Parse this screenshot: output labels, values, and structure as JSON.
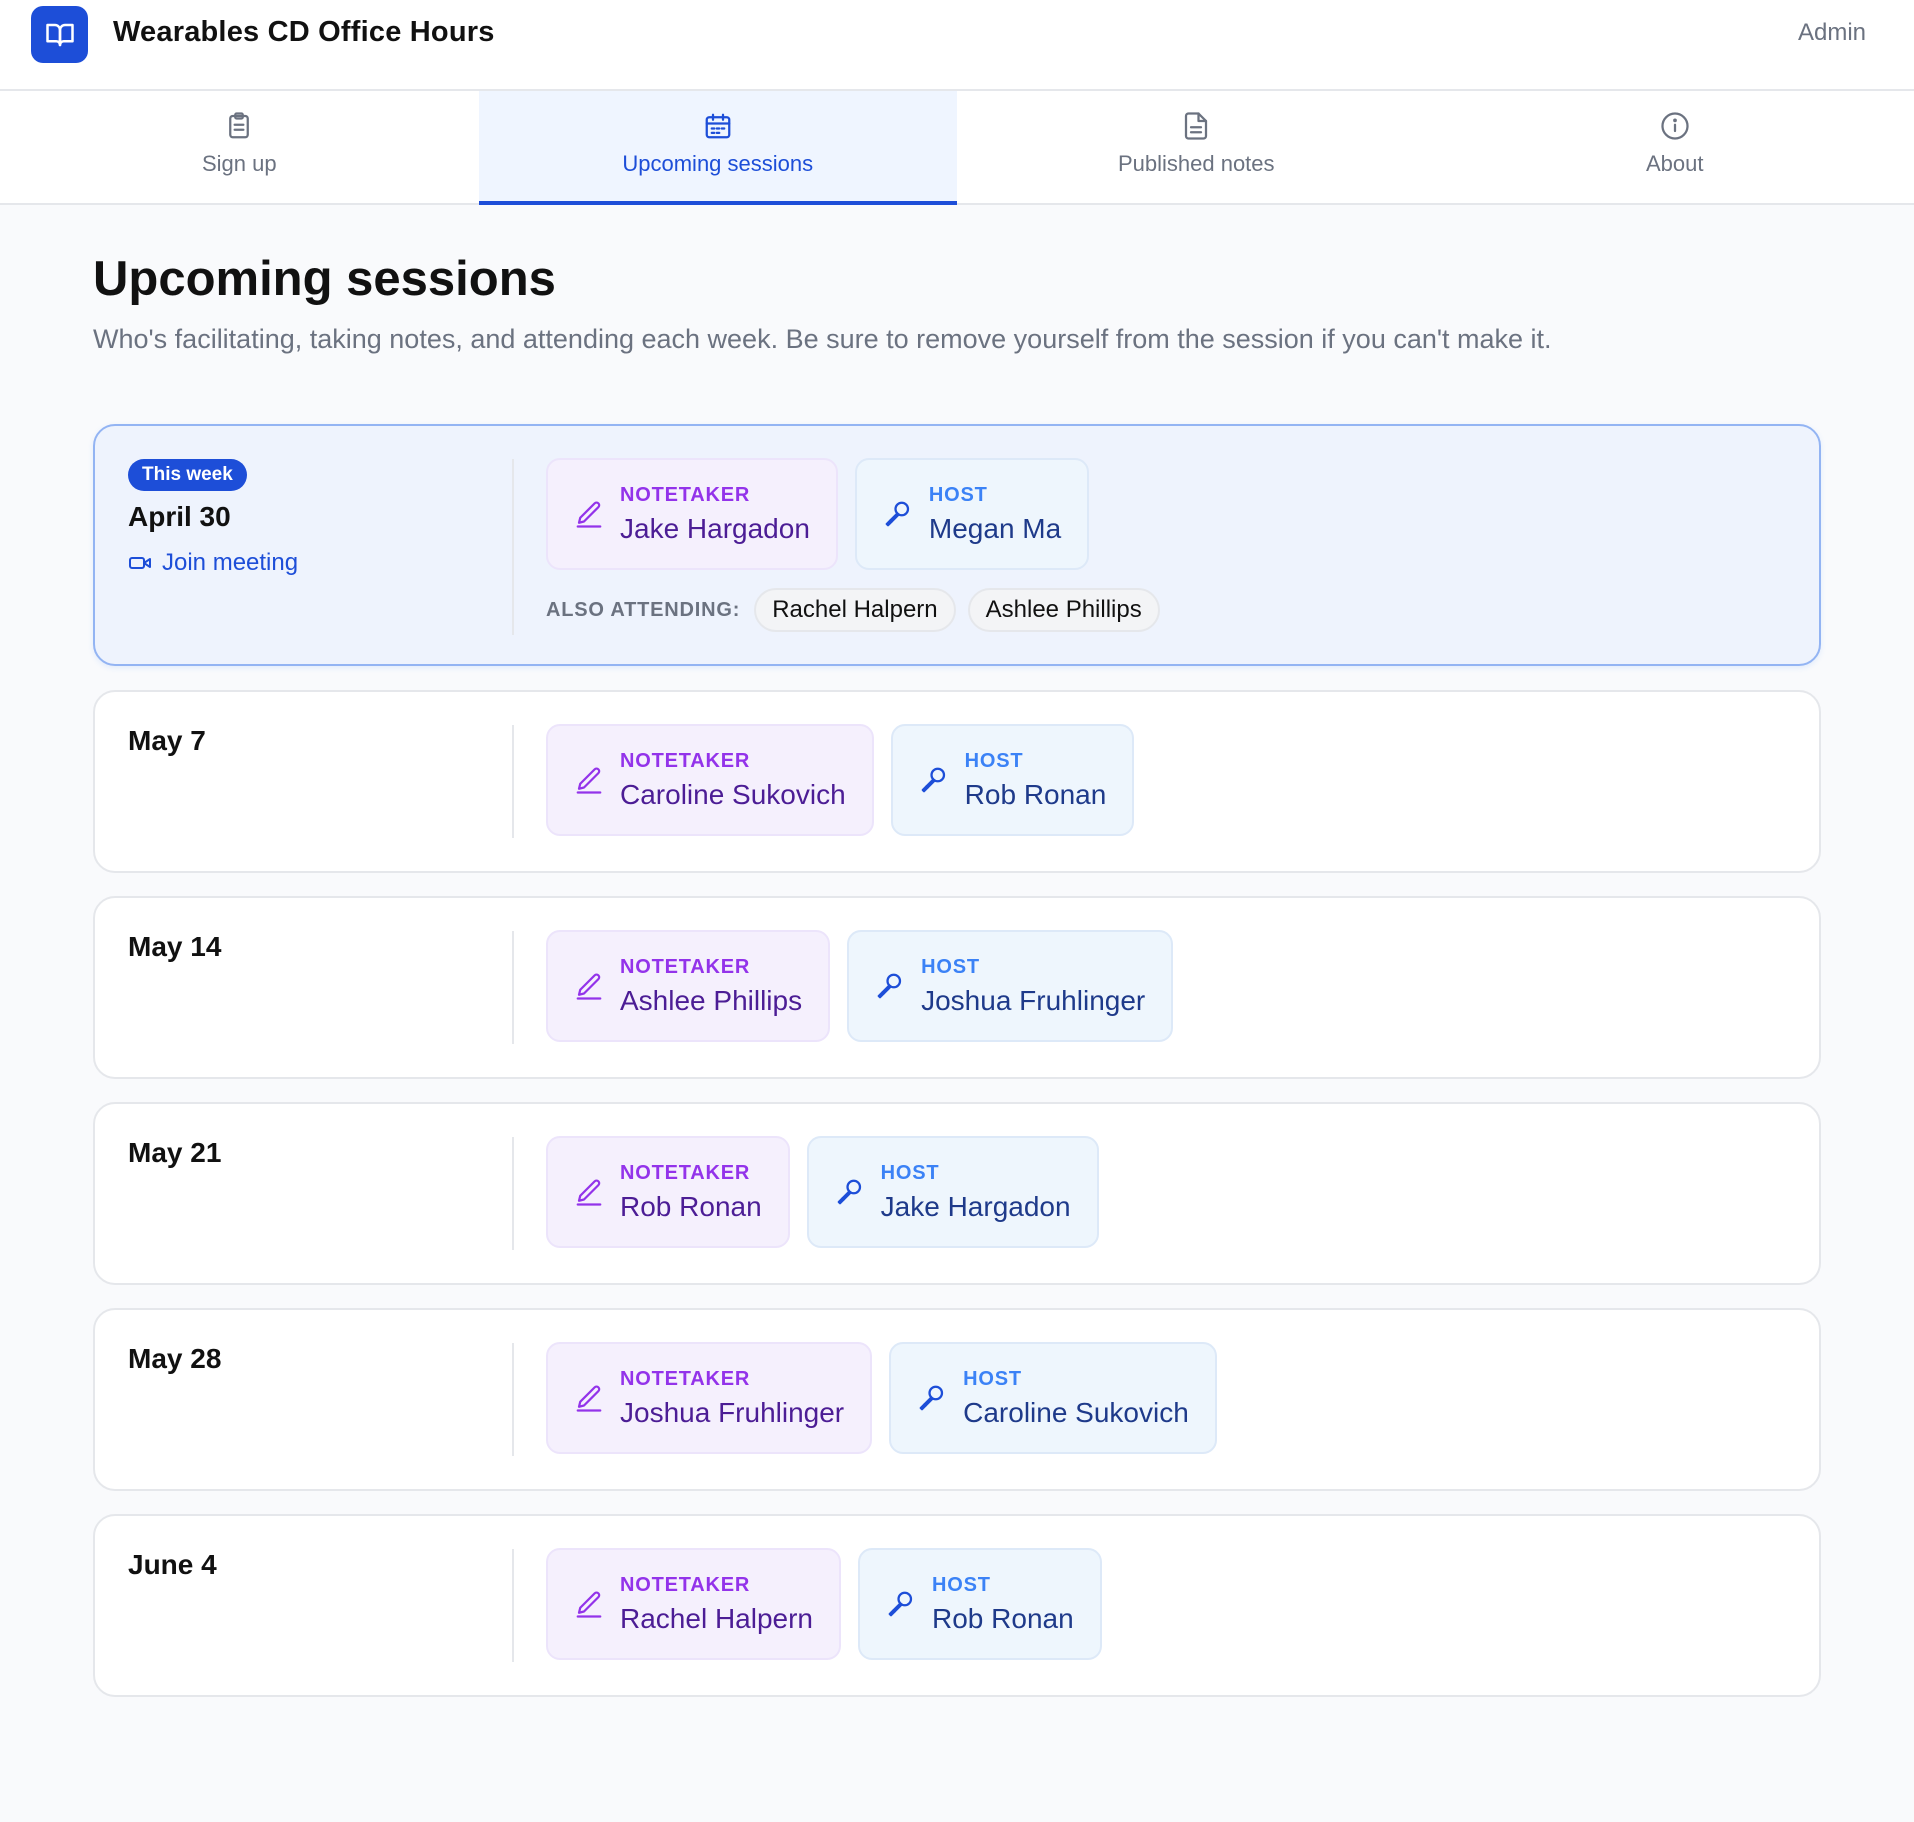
{
  "app": {
    "title": "Wearables CD Office Hours",
    "admin_label": "Admin",
    "logo_icon": "book-open-icon",
    "accent": "#1d4ed8"
  },
  "tabs": [
    {
      "label": "Sign up",
      "icon": "clipboard-icon",
      "active": false
    },
    {
      "label": "Upcoming sessions",
      "icon": "calendar-icon",
      "active": true
    },
    {
      "label": "Published notes",
      "icon": "document-icon",
      "active": false
    },
    {
      "label": "About",
      "icon": "info-icon",
      "active": false
    }
  ],
  "page": {
    "title": "Upcoming sessions",
    "subtitle": "Who's facilitating, taking notes, and attending each week. Be sure to remove yourself from the session if you can't make it."
  },
  "roles": {
    "notetaker_label": "NOTETAKER",
    "host_label": "HOST",
    "also_attending_label": "ALSO ATTENDING:"
  },
  "sessions": [
    {
      "badge": "This week",
      "date": "April 30",
      "join_label": "Join meeting",
      "notetaker": "Jake Hargadon",
      "host": "Megan Ma",
      "attending": [
        "Rachel Halpern",
        "Ashlee Phillips"
      ]
    },
    {
      "date": "May 7",
      "notetaker": "Caroline Sukovich",
      "host": "Rob Ronan"
    },
    {
      "date": "May 14",
      "notetaker": "Ashlee Phillips",
      "host": "Joshua Fruhlinger"
    },
    {
      "date": "May 21",
      "notetaker": "Rob Ronan",
      "host": "Jake Hargadon"
    },
    {
      "date": "May 28",
      "notetaker": "Joshua Fruhlinger",
      "host": "Caroline Sukovich"
    },
    {
      "date": "June 4",
      "notetaker": "Rachel Halpern",
      "host": "Rob Ronan"
    }
  ]
}
